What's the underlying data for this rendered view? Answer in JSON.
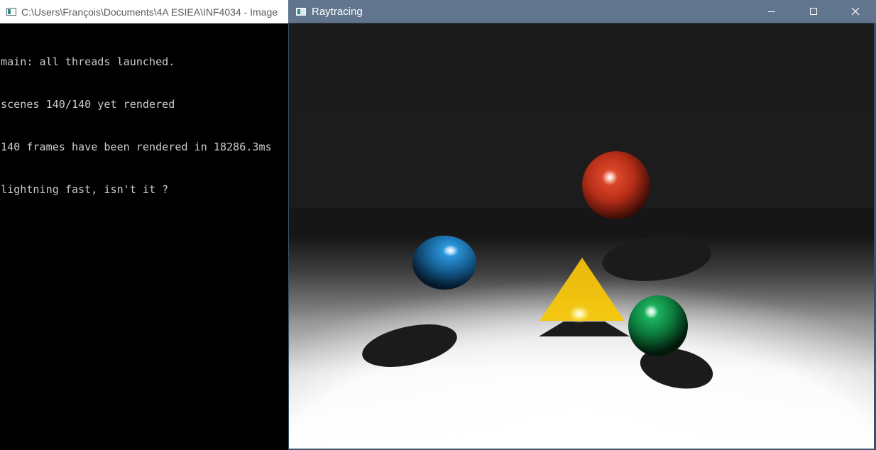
{
  "console": {
    "title": "C:\\Users\\François\\Documents\\4A ESIEA\\INF4034 - Image",
    "lines": [
      "main: all threads launched.",
      "scenes 140/140 yet rendered",
      "140 frames have been rendered in 18286.3ms",
      "lightning fast, isn't it ?"
    ]
  },
  "raytracing": {
    "title": "Raytracing",
    "icons": {
      "app": "window-icon",
      "minimize": "minimize-icon",
      "maximize": "maximize-icon",
      "close": "close-icon"
    },
    "scene": {
      "spheres": [
        {
          "name": "red-sphere",
          "color": "#d63a22"
        },
        {
          "name": "blue-sphere",
          "color": "#1f86c8"
        },
        {
          "name": "green-sphere",
          "color": "#14a052"
        }
      ],
      "pyramid_color": "#f2c40e",
      "background_color": "#1b1b1b",
      "floor_color": "#ffffff"
    }
  }
}
